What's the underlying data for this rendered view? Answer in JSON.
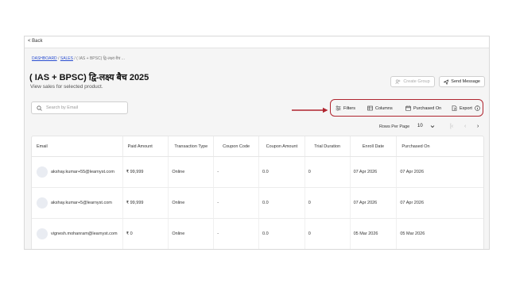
{
  "topbar": {
    "back_label": "< Back"
  },
  "breadcrumb": {
    "item1": "DASHBOARD",
    "sep1": " / ",
    "item2": "SALES",
    "sep2": " / ",
    "item3": "( IAS + BPSC) द्वि-लक्ष्य बैच ..."
  },
  "header": {
    "title": "( IAS + BPSC) द्वि-लक्ष्य बैच 2025",
    "subtitle": "View sales for selected product.",
    "create_group_label": "Create Group",
    "send_message_label": "Send Message"
  },
  "search": {
    "placeholder": "Search by Email"
  },
  "toolbar": {
    "filters_label": "Filters",
    "columns_label": "Columns",
    "purchased_on_label": "Purchased On",
    "export_label": "Export",
    "highlight_color": "#b0252f"
  },
  "pagination": {
    "rows_per_page_label": "Rows Per Page",
    "rows_per_page_value": "10"
  },
  "table": {
    "columns": [
      "Email",
      "Paid Amount",
      "Transaction Type",
      "Coupon Code",
      "Coupon Amount",
      "Trial Duration",
      "Enroll Date",
      "Purchased On"
    ],
    "rows": [
      {
        "email": "akshay.kumar+55@learnyst.com",
        "paid": "₹ 99,999",
        "type": "Online",
        "coupon": "-",
        "coupon_amount": "0.0",
        "trial": "0",
        "enroll": "07 Apr 2026",
        "purchased": "07 Apr 2026"
      },
      {
        "email": "akshay.kumar+5@learnyst.com",
        "paid": "₹ 99,999",
        "type": "Online",
        "coupon": "-",
        "coupon_amount": "0.0",
        "trial": "0",
        "enroll": "07 Apr 2026",
        "purchased": "07 Apr 2026"
      },
      {
        "email": "vignesh.mohanram@learnyst.com",
        "paid": "₹ 0",
        "type": "Online",
        "coupon": "-",
        "coupon_amount": "0.0",
        "trial": "0",
        "enroll": "05 Mar 2026",
        "purchased": "05 Mar 2026"
      }
    ]
  }
}
